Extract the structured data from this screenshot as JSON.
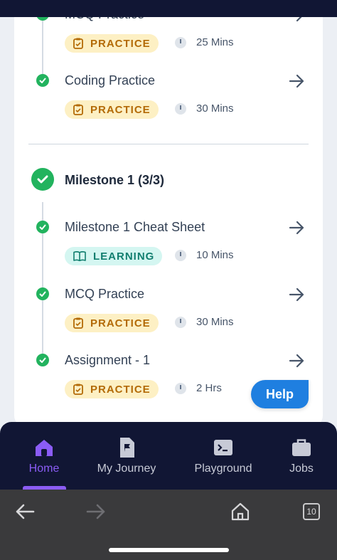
{
  "items_top": [
    {
      "title": "MCQ Practice",
      "tag": "PRACTICE",
      "tag_type": "practice",
      "duration": "25 Mins"
    },
    {
      "title": "Coding Practice",
      "tag": "PRACTICE",
      "tag_type": "practice",
      "duration": "30 Mins"
    }
  ],
  "milestone": {
    "title": "Milestone 1 (3/3)",
    "items": [
      {
        "title": "Milestone 1 Cheat Sheet",
        "tag": "LEARNING",
        "tag_type": "learning",
        "duration": "10 Mins"
      },
      {
        "title": "MCQ Practice",
        "tag": "PRACTICE",
        "tag_type": "practice",
        "duration": "30 Mins"
      },
      {
        "title": "Assignment - 1",
        "tag": "PRACTICE",
        "tag_type": "practice",
        "duration": "2 Hrs"
      }
    ]
  },
  "help_label": "Help",
  "nav": {
    "items": [
      {
        "label": "Home",
        "icon": "home-icon",
        "active": true
      },
      {
        "label": "My Journey",
        "icon": "journey-flag-icon",
        "active": false
      },
      {
        "label": "Playground",
        "icon": "terminal-icon",
        "active": false
      },
      {
        "label": "Jobs",
        "icon": "briefcase-icon",
        "active": false
      }
    ]
  },
  "browser": {
    "tabs_count": "10"
  },
  "colors": {
    "complete_green": "#22b35e",
    "nav_bg": "#111634",
    "accent_purple": "#8b5cf6",
    "help_blue": "#1f7fe0",
    "practice_bg": "#fdf0c4",
    "learning_bg": "#d4f6f1"
  }
}
